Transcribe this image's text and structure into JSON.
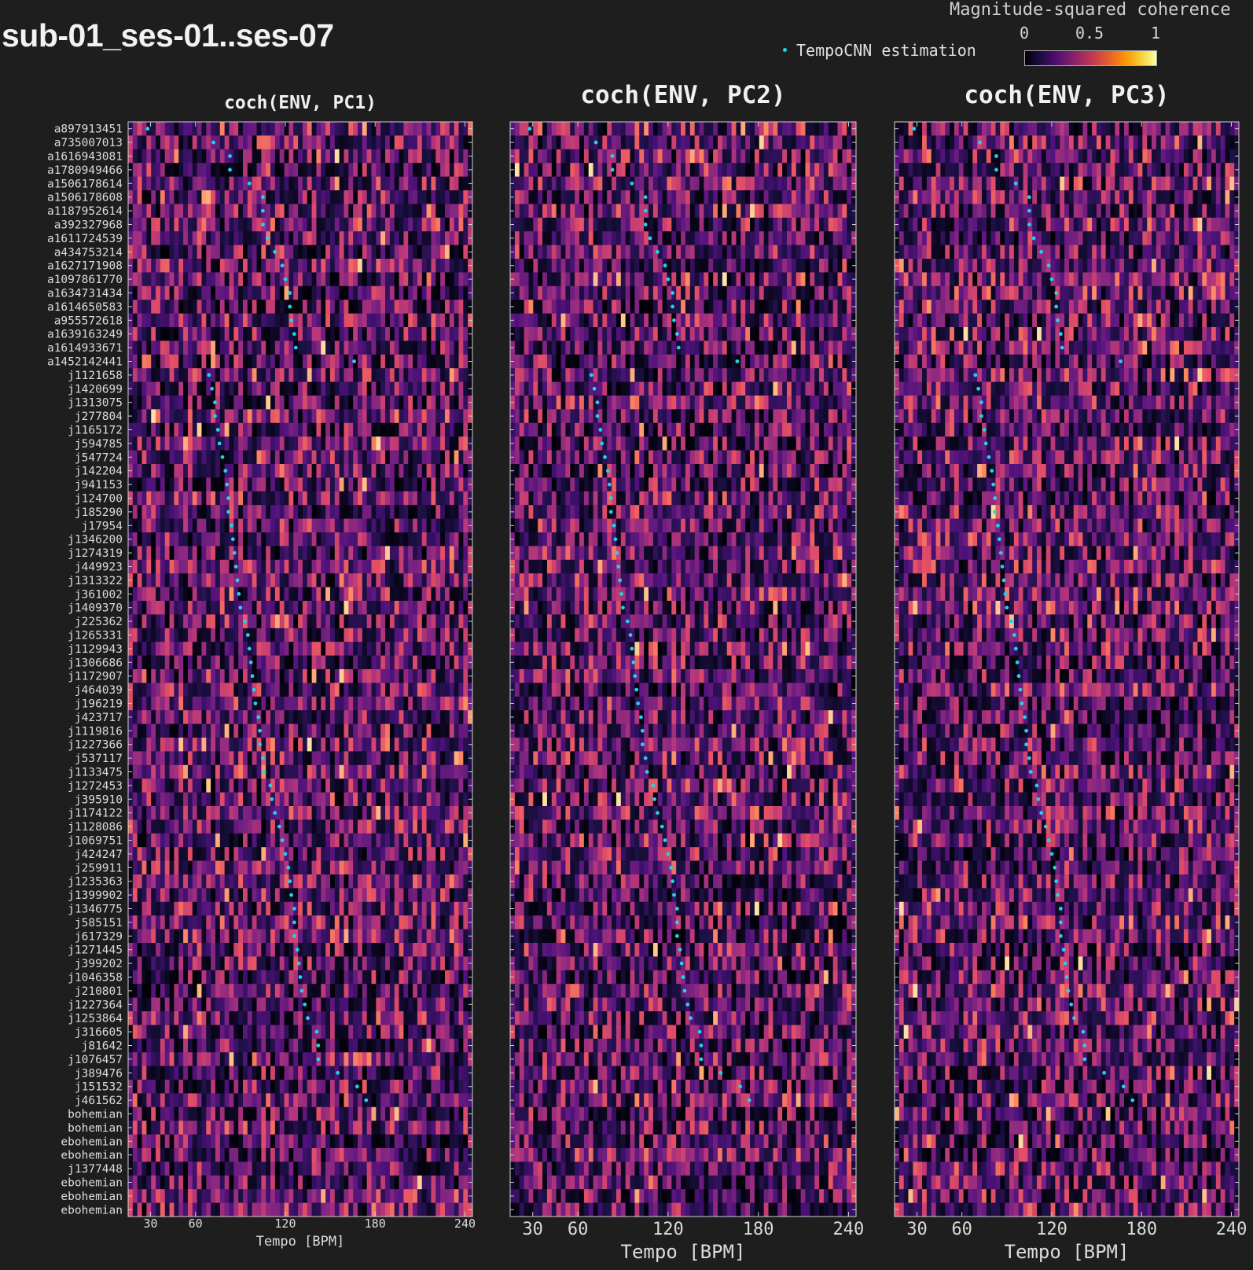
{
  "title": "sub-01_ses-01..ses-07",
  "legend": {
    "label": "TempoCNN estimation",
    "marker_color": "#22d3e6"
  },
  "colorbar": {
    "title": "Magnitude-squared coherence",
    "ticks": [
      "0",
      "0.5",
      "1"
    ],
    "range": [
      0,
      1
    ],
    "colormap": "magma"
  },
  "chart_data": [
    {
      "type": "heatmap",
      "title": "coch(ENV, PC1)",
      "xlabel": "Tempo [BPM]",
      "xticks": [
        30,
        60,
        120,
        180,
        240
      ],
      "xlim": [
        15,
        245
      ],
      "ylabel": "",
      "series": [
        {
          "name": "TempoCNN estimation",
          "type": "scatter"
        }
      ]
    },
    {
      "type": "heatmap",
      "title": "coch(ENV, PC2)",
      "xlabel": "Tempo [BPM]",
      "xticks": [
        30,
        60,
        120,
        180,
        240
      ],
      "xlim": [
        15,
        245
      ],
      "series": [
        {
          "name": "TempoCNN estimation",
          "type": "scatter"
        }
      ]
    },
    {
      "type": "heatmap",
      "title": "coch(ENV, PC3)",
      "xlabel": "Tempo [BPM]",
      "xticks": [
        30,
        60,
        120,
        180,
        240
      ],
      "xlim": [
        15,
        245
      ],
      "series": [
        {
          "name": "TempoCNN estimation",
          "type": "scatter"
        }
      ]
    }
  ],
  "rows": [
    "a897913451",
    "a735007013",
    "a1616943081",
    "a1780949466",
    "a1506178614",
    "a1506178608",
    "a1187952614",
    "a392327968",
    "a1611724539",
    "a434753214",
    "a1627171908",
    "a1097861770",
    "a1634731434",
    "a1614650583",
    "a955572618",
    "a1639163249",
    "a1614933671",
    "a1452142441",
    "j1121658",
    "j1420699",
    "j1313075",
    "j277804",
    "j1165172",
    "j594785",
    "j547724",
    "j142204",
    "j941153",
    "j124700",
    "j185290",
    "j17954",
    "j1346200",
    "j1274319",
    "j449923",
    "j1313322",
    "j361002",
    "j1409370",
    "j225362",
    "j1265331",
    "j1129943",
    "j1306686",
    "j1172907",
    "j464039",
    "j196219",
    "j423717",
    "j1119816",
    "j1227366",
    "j537117",
    "j1133475",
    "j1272453",
    "j395910",
    "j1174122",
    "j1128086",
    "j1069751",
    "j424247",
    "j259911",
    "j1235363",
    "j1399902",
    "j1346775",
    "j585151",
    "j617329",
    "j1271445",
    "j399202",
    "j1046358",
    "j210801",
    "j1227364",
    "j1253864",
    "j316605",
    "j81642",
    "j1076457",
    "j389476",
    "j151532",
    "j461562",
    "bohemian",
    "bohemian",
    "ebohemian",
    "ebohemian",
    "j1377448",
    "ebohemian",
    "ebohemian",
    "ebohemian"
  ],
  "tempo_estimates_bpm": [
    28,
    72,
    83,
    83,
    96,
    105,
    105,
    105,
    108,
    113,
    118,
    120,
    123,
    123,
    124,
    126,
    127,
    166,
    69,
    71,
    73,
    73,
    75,
    76,
    78,
    80,
    81,
    82,
    82,
    84,
    85,
    86,
    87,
    88,
    89,
    90,
    93,
    95,
    96,
    97,
    98,
    99,
    100,
    102,
    103,
    103,
    105,
    106,
    110,
    111,
    113,
    116,
    118,
    120,
    122,
    123,
    124,
    126,
    126,
    126,
    128,
    129,
    130,
    131,
    133,
    135,
    141,
    142,
    142,
    155,
    168,
    174,
    null,
    null,
    null,
    null,
    null,
    null,
    null,
    null
  ]
}
